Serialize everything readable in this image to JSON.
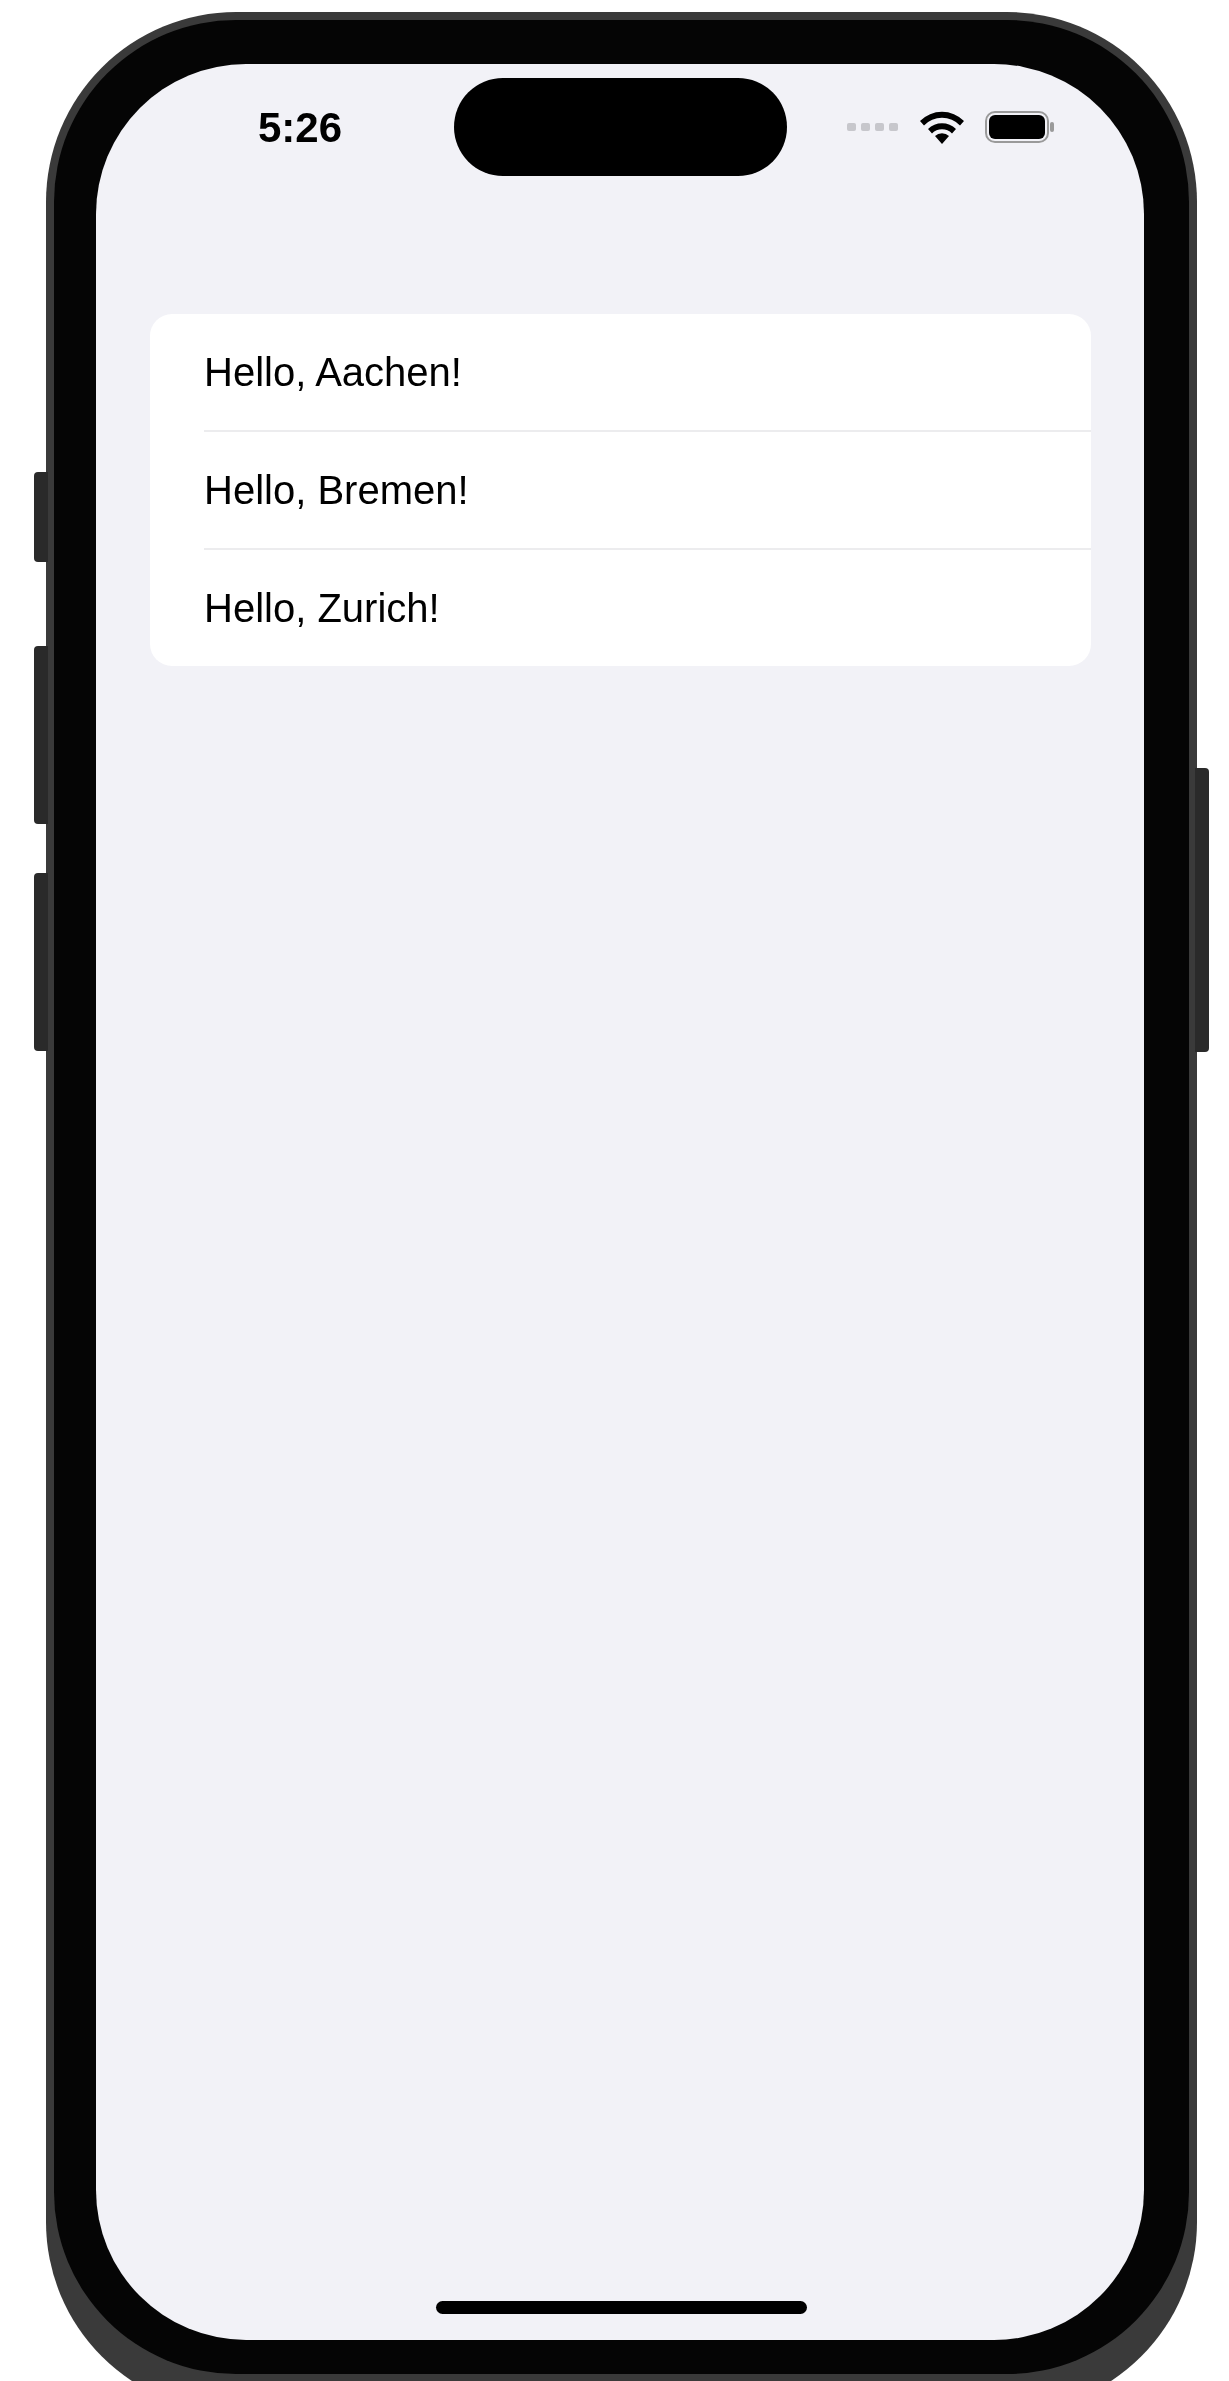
{
  "status_bar": {
    "time": "5:26"
  },
  "list": {
    "items": [
      {
        "label": "Hello, Aachen!"
      },
      {
        "label": "Hello, Bremen!"
      },
      {
        "label": "Hello, Zurich!"
      }
    ]
  }
}
